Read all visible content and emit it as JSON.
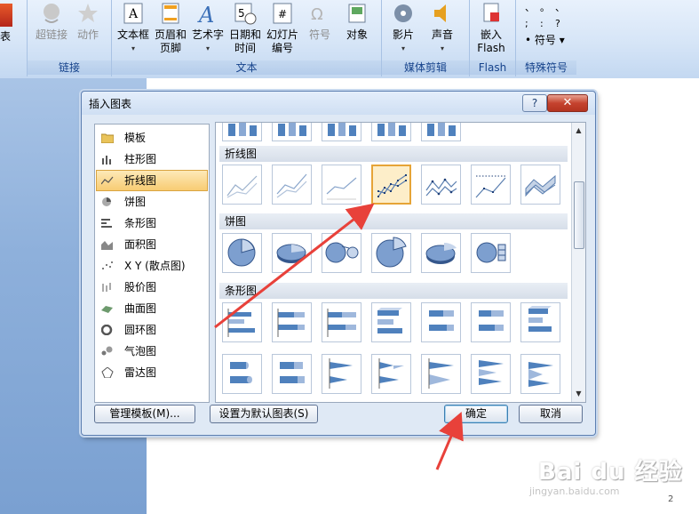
{
  "ribbon": {
    "left_partial": "表",
    "links_group": {
      "label": "链接",
      "items": [
        "超链接",
        "动作"
      ]
    },
    "text_group": {
      "label": "文本",
      "items": [
        {
          "l1": "文本框",
          "l2": ""
        },
        {
          "l1": "页眉和",
          "l2": "页脚"
        },
        {
          "l1": "艺术字",
          "l2": ""
        },
        {
          "l1": "日期和",
          "l2": "时间"
        },
        {
          "l1": "幻灯片",
          "l2": "编号"
        },
        {
          "l1": "符号",
          "l2": ""
        },
        {
          "l1": "对象",
          "l2": ""
        }
      ]
    },
    "media_group": {
      "label": "媒体剪辑",
      "items": [
        "影片",
        "声音"
      ]
    },
    "flash_group": {
      "label": "Flash",
      "l1": "嵌入",
      "l2": "Flash"
    },
    "special_group": {
      "label": "特殊符号",
      "symbols": [
        "、",
        "。",
        "、",
        ";",
        ":",
        "?"
      ],
      "btn": "符号"
    }
  },
  "dialog": {
    "title": "插入图表",
    "help": "?",
    "close": "✕",
    "categories": [
      {
        "label": "模板",
        "icon": "folder-icon"
      },
      {
        "label": "柱形图",
        "icon": "column-chart-icon"
      },
      {
        "label": "折线图",
        "icon": "line-chart-icon"
      },
      {
        "label": "饼图",
        "icon": "pie-chart-icon"
      },
      {
        "label": "条形图",
        "icon": "bar-chart-icon"
      },
      {
        "label": "面积图",
        "icon": "area-chart-icon"
      },
      {
        "label": "X Y (散点图)",
        "icon": "scatter-chart-icon"
      },
      {
        "label": "股价图",
        "icon": "stock-chart-icon"
      },
      {
        "label": "曲面图",
        "icon": "surface-chart-icon"
      },
      {
        "label": "圆环图",
        "icon": "doughnut-chart-icon"
      },
      {
        "label": "气泡图",
        "icon": "bubble-chart-icon"
      },
      {
        "label": "雷达图",
        "icon": "radar-chart-icon"
      }
    ],
    "selected_category": "折线图",
    "sections": {
      "line": "折线图",
      "pie": "饼图",
      "bar": "条形图"
    },
    "buttons": {
      "manage": "管理模板(M)...",
      "set_default": "设置为默认图表(S)",
      "ok": "确定",
      "cancel": "取消"
    }
  },
  "watermark": {
    "logo": "Bai du 经验",
    "url": "jingyan.baidu.com"
  },
  "page_number": "2",
  "colors": {
    "accent": "#f8cc73",
    "arrow": "#e8413a",
    "chart_blue": "#4f81bd"
  }
}
